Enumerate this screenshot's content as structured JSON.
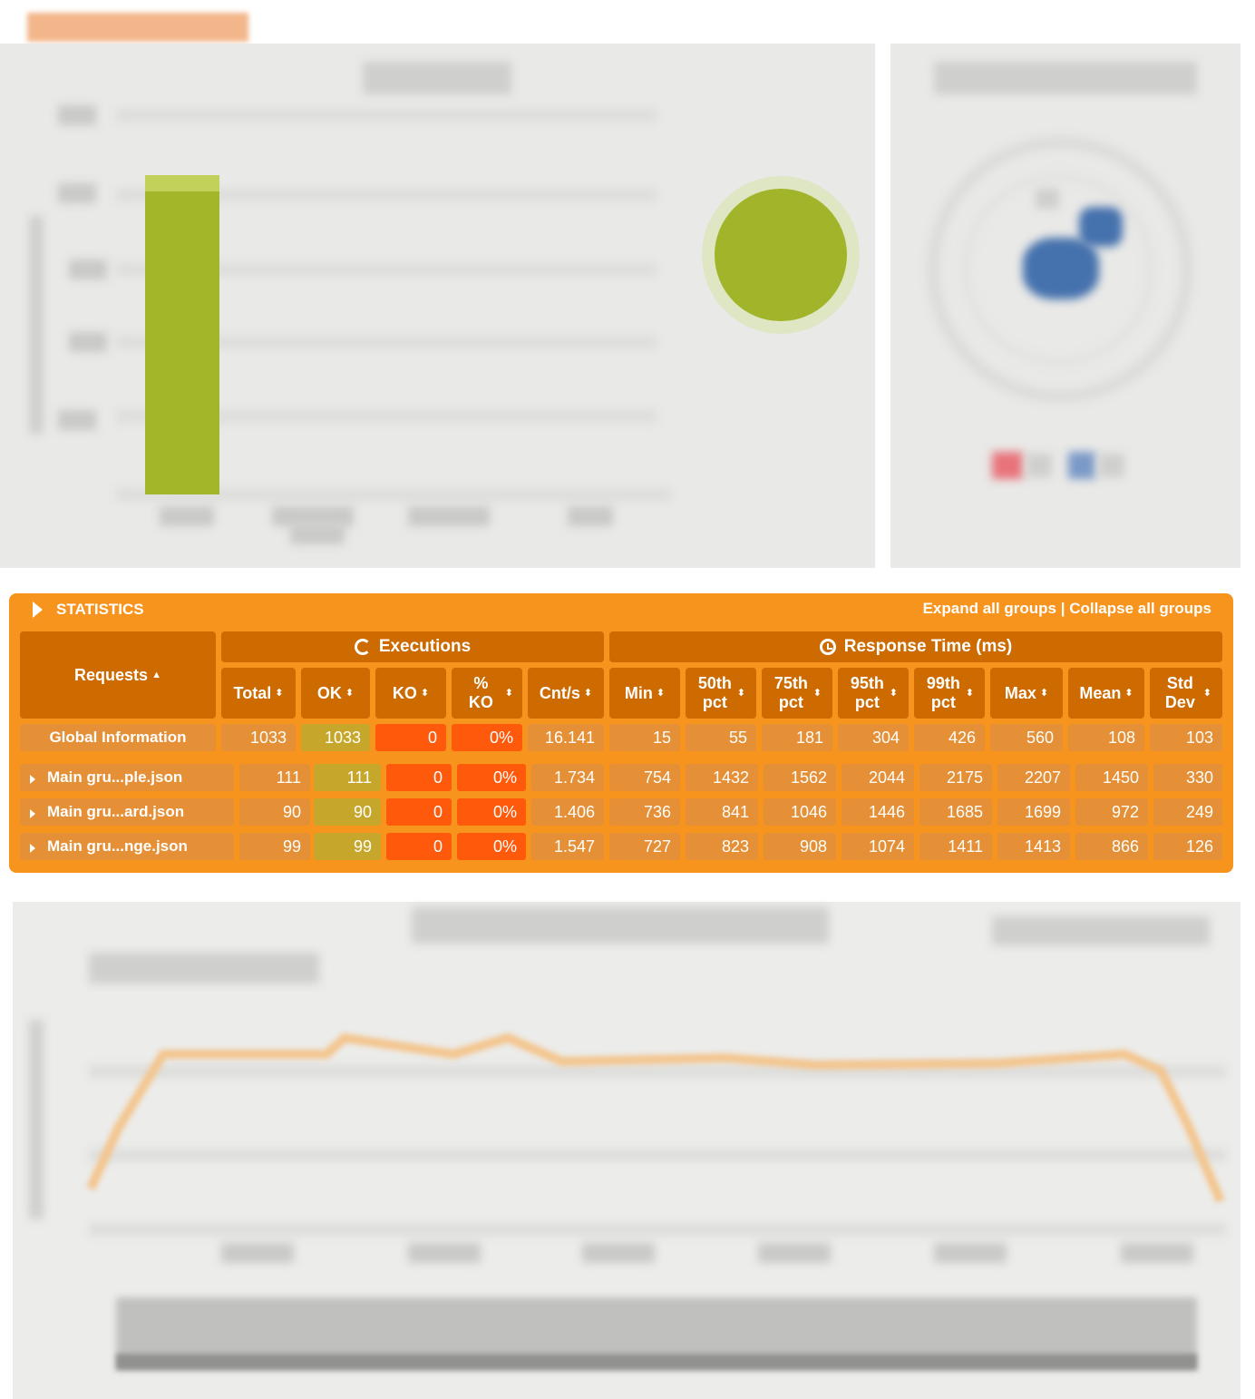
{
  "statistics": {
    "title": "STATISTICS",
    "expand_label": "Expand all groups",
    "separator": "|",
    "collapse_label": "Collapse all groups",
    "group_headers": {
      "executions": "Executions",
      "response_time": "Response Time (ms)"
    },
    "columns": {
      "requests": "Requests",
      "total": "Total",
      "ok": "OK",
      "ko": "KO",
      "pct_ko": "% KO",
      "cnt_s": "Cnt/s",
      "min": "Min",
      "p50": "50th pct",
      "p75": "75th pct",
      "p95": "95th pct",
      "p99": "99th pct",
      "max": "Max",
      "mean": "Mean",
      "std": "Std Dev"
    },
    "rows": [
      {
        "name": "Global Information",
        "total": "1033",
        "ok": "1033",
        "ko": "0",
        "pct_ko": "0%",
        "cnt_s": "16.141",
        "min": "15",
        "p50": "55",
        "p75": "181",
        "p95": "304",
        "p99": "426",
        "max": "560",
        "mean": "108",
        "std": "103"
      },
      {
        "name": "Main gru...ple.json",
        "total": "111",
        "ok": "111",
        "ko": "0",
        "pct_ko": "0%",
        "cnt_s": "1.734",
        "min": "754",
        "p50": "1432",
        "p75": "1562",
        "p95": "2044",
        "p99": "2175",
        "max": "2207",
        "mean": "1450",
        "std": "330"
      },
      {
        "name": "Main gru...ard.json",
        "total": "90",
        "ok": "90",
        "ko": "0",
        "pct_ko": "0%",
        "cnt_s": "1.406",
        "min": "736",
        "p50": "841",
        "p75": "1046",
        "p95": "1446",
        "p99": "1685",
        "max": "1699",
        "mean": "972",
        "std": "249"
      },
      {
        "name": "Main gru...nge.json",
        "total": "99",
        "ok": "99",
        "ko": "0",
        "pct_ko": "0%",
        "cnt_s": "1.547",
        "min": "727",
        "p50": "823",
        "p75": "908",
        "p95": "1074",
        "p99": "1411",
        "max": "1413",
        "mean": "866",
        "std": "126"
      }
    ]
  },
  "colors": {
    "panel": "#f7941e",
    "header": "#cd6a00",
    "ok": "#c7a72b",
    "ko": "#ff5a0c"
  }
}
